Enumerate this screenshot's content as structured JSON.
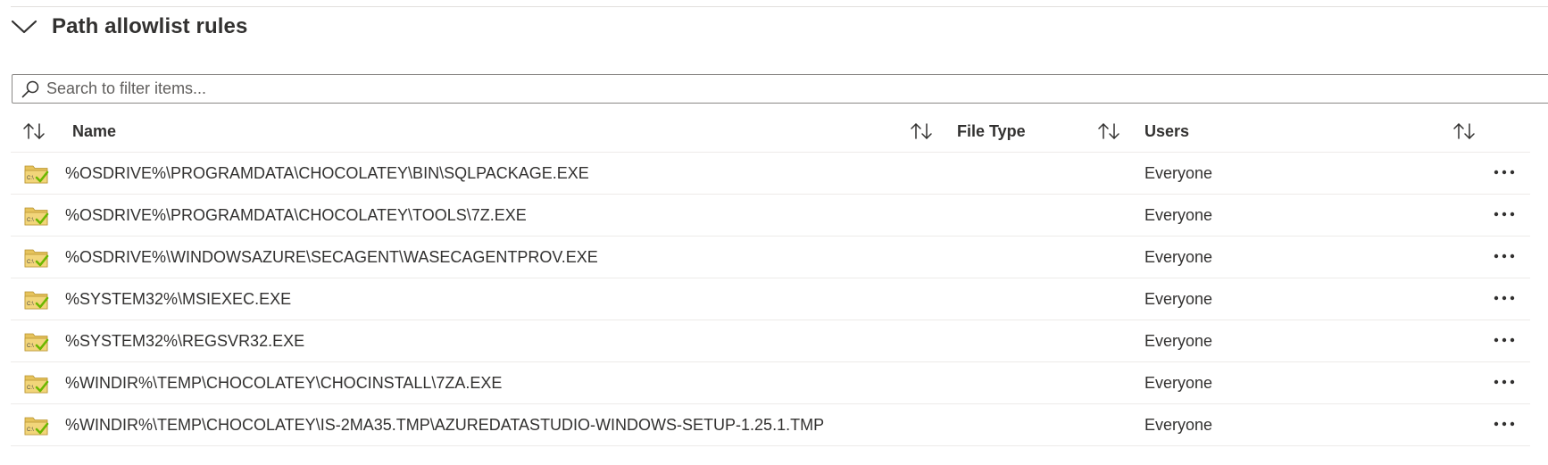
{
  "section": {
    "title": "Path allowlist rules",
    "expand_icon": "chevron-down-icon"
  },
  "search": {
    "placeholder": "Search to filter items...",
    "value": "",
    "icon": "search-icon"
  },
  "columns": {
    "name": "Name",
    "file_type": "File Type",
    "users": "Users",
    "sort_icon": "sort-up-down-icon"
  },
  "rows": [
    {
      "name": "%OSDRIVE%\\PROGRAMDATA\\CHOCOLATEY\\BIN\\SQLPACKAGE.EXE",
      "file_type": "",
      "users": "Everyone"
    },
    {
      "name": "%OSDRIVE%\\PROGRAMDATA\\CHOCOLATEY\\TOOLS\\7Z.EXE",
      "file_type": "",
      "users": "Everyone"
    },
    {
      "name": "%OSDRIVE%\\WINDOWSAZURE\\SECAGENT\\WASECAGENTPROV.EXE",
      "file_type": "",
      "users": "Everyone"
    },
    {
      "name": "%SYSTEM32%\\MSIEXEC.EXE",
      "file_type": "",
      "users": "Everyone"
    },
    {
      "name": "%SYSTEM32%\\REGSVR32.EXE",
      "file_type": "",
      "users": "Everyone"
    },
    {
      "name": "%WINDIR%\\TEMP\\CHOCOLATEY\\CHOCINSTALL\\7ZA.EXE",
      "file_type": "",
      "users": "Everyone"
    },
    {
      "name": "%WINDIR%\\TEMP\\CHOCOLATEY\\IS-2MA35.TMP\\AZUREDATASTUDIO-WINDOWS-SETUP-1.25.1.TMP",
      "file_type": "",
      "users": "Everyone"
    }
  ],
  "row_icon": "path-rule-folder-icon",
  "row_action_icon": "more-options-icon",
  "colors": {
    "text": "#323130",
    "border": "#edebe9",
    "folder": "#d9b44a",
    "check": "#6bb700"
  }
}
